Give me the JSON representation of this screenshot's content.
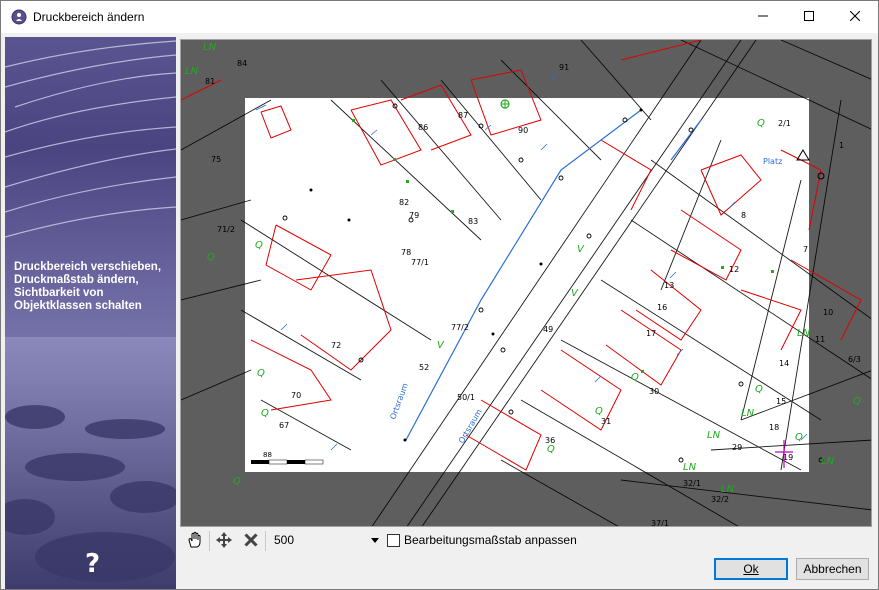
{
  "window": {
    "title": "Druckbereich ändern",
    "icon": "globe-gear-icon"
  },
  "titlebar_controls": {
    "minimize_icon": "minimize-icon",
    "maximize_icon": "maximize-icon",
    "close_icon": "close-icon"
  },
  "side_panel": {
    "help_text": "Druckbereich verschieben, Druckmaßstab ändern, Sichtbarkeit von Objektklassen schalten",
    "help_button": "?"
  },
  "map": {
    "parcel_numbers": [
      "84",
      "81",
      "91",
      "86",
      "87",
      "90",
      "2/1",
      "75",
      "82",
      "83",
      "8",
      "71/2",
      "79",
      "78",
      "77/1",
      "7",
      "12",
      "13",
      "16",
      "10",
      "17",
      "72",
      "77/2",
      "49",
      "14",
      "11",
      "6/3",
      "52",
      "30",
      "15",
      "70",
      "50/1",
      "31",
      "67",
      "36",
      "18",
      "29",
      "19",
      "32/1",
      "32/2",
      "37/1",
      "1"
    ],
    "labels": {
      "platz": "Platz",
      "ortsraum_1": "Ortsraum",
      "ortsraum_2": "Ortsraum",
      "ln": "LN",
      "q": "Q",
      "v": "V"
    },
    "scalebar_label": "88"
  },
  "toolbar": {
    "pan_icon": "hand-icon",
    "move_icon": "move-arrows-icon",
    "delete_icon": "x-icon",
    "scale_value": "500",
    "checkbox_label": "Bearbeitungsmaßstab anpassen",
    "checkbox_checked": false
  },
  "buttons": {
    "ok": "Ok",
    "cancel": "Abbrechen"
  },
  "colors": {
    "map_background": "#5e5e5e",
    "print_area": "#ffffff",
    "building_outline": "#e00000",
    "green_labels": "#22aa22",
    "blue_labels": "#2a6fd6"
  }
}
